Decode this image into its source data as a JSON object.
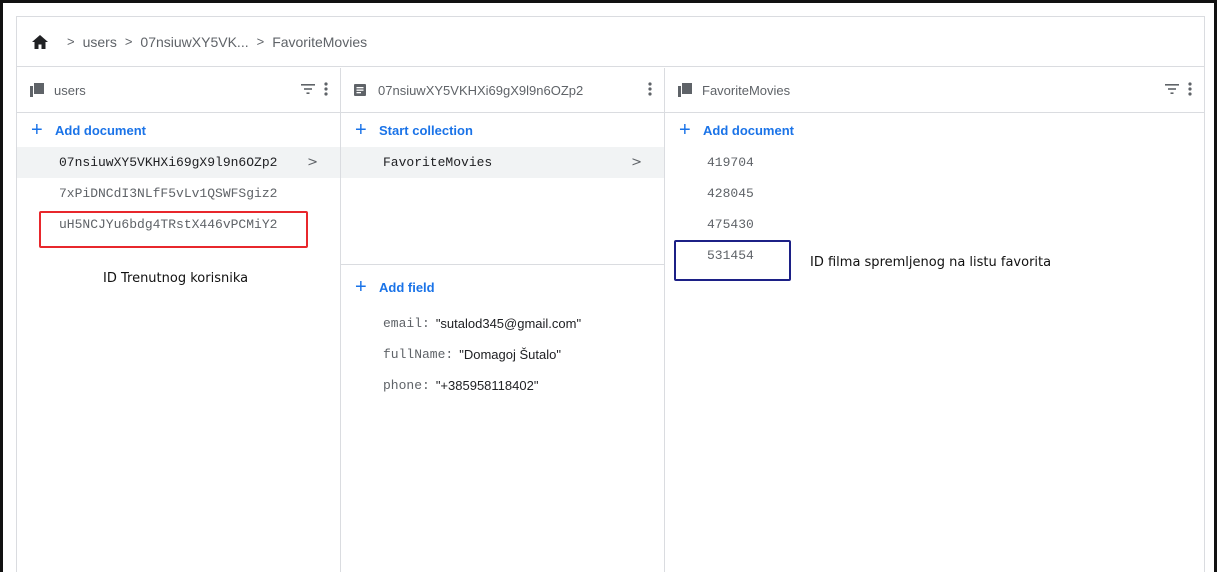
{
  "breadcrumb": {
    "home_icon": "home-icon",
    "items": [
      "users",
      "07nsiuwXY5VK...",
      "FavoriteMovies"
    ]
  },
  "column1": {
    "header": "users",
    "icon": "collection-icon",
    "action_label": "Add document",
    "rows": [
      "07nsiuwXY5VKHXi69gX9l9n6OZp2",
      "7xPiDNCdI3NLfF5vLv1QSWFSgiz2",
      "uH5NCJYu6bdg4TRstX446vPCMiY2"
    ]
  },
  "column2": {
    "header": "07nsiuwXY5VKHXi69gX9l9n6OZp2",
    "icon": "document-icon",
    "action_label": "Start collection",
    "rows": [
      "FavoriteMovies"
    ],
    "field_action_label": "Add field",
    "fields": [
      {
        "key": "email:",
        "value": "\"sutalod345@gmail.com\""
      },
      {
        "key": "fullName:",
        "value": "\"Domagoj Šutalo\""
      },
      {
        "key": "phone:",
        "value": "\"+385958118402\""
      }
    ]
  },
  "column3": {
    "header": "FavoriteMovies",
    "icon": "collection-icon",
    "action_label": "Add document",
    "rows": [
      "419704",
      "428045",
      "475430",
      "531454"
    ]
  },
  "annotations": {
    "current_user": "ID Trenutnog korisnika",
    "favorite_movie": "ID filma spremljenog na listu favorita"
  },
  "colors": {
    "accent": "#1a73e8",
    "highlight_red": "#e8272c",
    "highlight_blue": "#1c2086"
  }
}
